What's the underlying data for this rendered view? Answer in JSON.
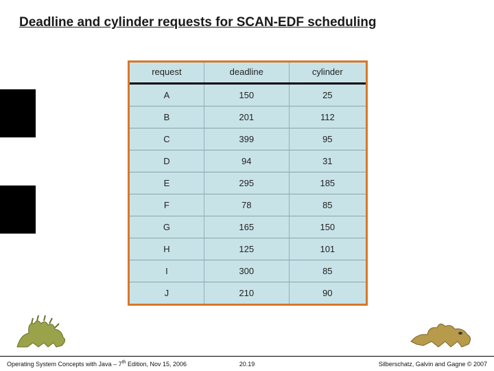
{
  "title": "Deadline and cylinder requests for SCAN-EDF scheduling",
  "table": {
    "headers": [
      "request",
      "deadline",
      "cylinder"
    ],
    "rows": [
      {
        "r": "A",
        "d": "150",
        "c": "25"
      },
      {
        "r": "B",
        "d": "201",
        "c": "112"
      },
      {
        "r": "C",
        "d": "399",
        "c": "95"
      },
      {
        "r": "D",
        "d": "94",
        "c": "31"
      },
      {
        "r": "E",
        "d": "295",
        "c": "185"
      },
      {
        "r": "F",
        "d": "78",
        "c": "85"
      },
      {
        "r": "G",
        "d": "165",
        "c": "150"
      },
      {
        "r": "H",
        "d": "125",
        "c": "101"
      },
      {
        "r": "I",
        "d": "300",
        "c": "85"
      },
      {
        "r": "J",
        "d": "210",
        "c": "90"
      }
    ]
  },
  "footer": {
    "left_a": "Operating System Concepts with Java – 7",
    "left_sup": "th",
    "left_b": " Edition, Nov 15, 2006",
    "center": "20.19",
    "right_a": "Silberschatz, Galvin and Gagne ",
    "right_b": "© 2007"
  },
  "chart_data": {
    "type": "table",
    "title": "Deadline and cylinder requests for SCAN-EDF scheduling",
    "columns": [
      "request",
      "deadline",
      "cylinder"
    ],
    "rows": [
      [
        "A",
        150,
        25
      ],
      [
        "B",
        201,
        112
      ],
      [
        "C",
        399,
        95
      ],
      [
        "D",
        94,
        31
      ],
      [
        "E",
        295,
        185
      ],
      [
        "F",
        78,
        85
      ],
      [
        "G",
        165,
        150
      ],
      [
        "H",
        125,
        101
      ],
      [
        "I",
        300,
        85
      ],
      [
        "J",
        210,
        90
      ]
    ]
  }
}
